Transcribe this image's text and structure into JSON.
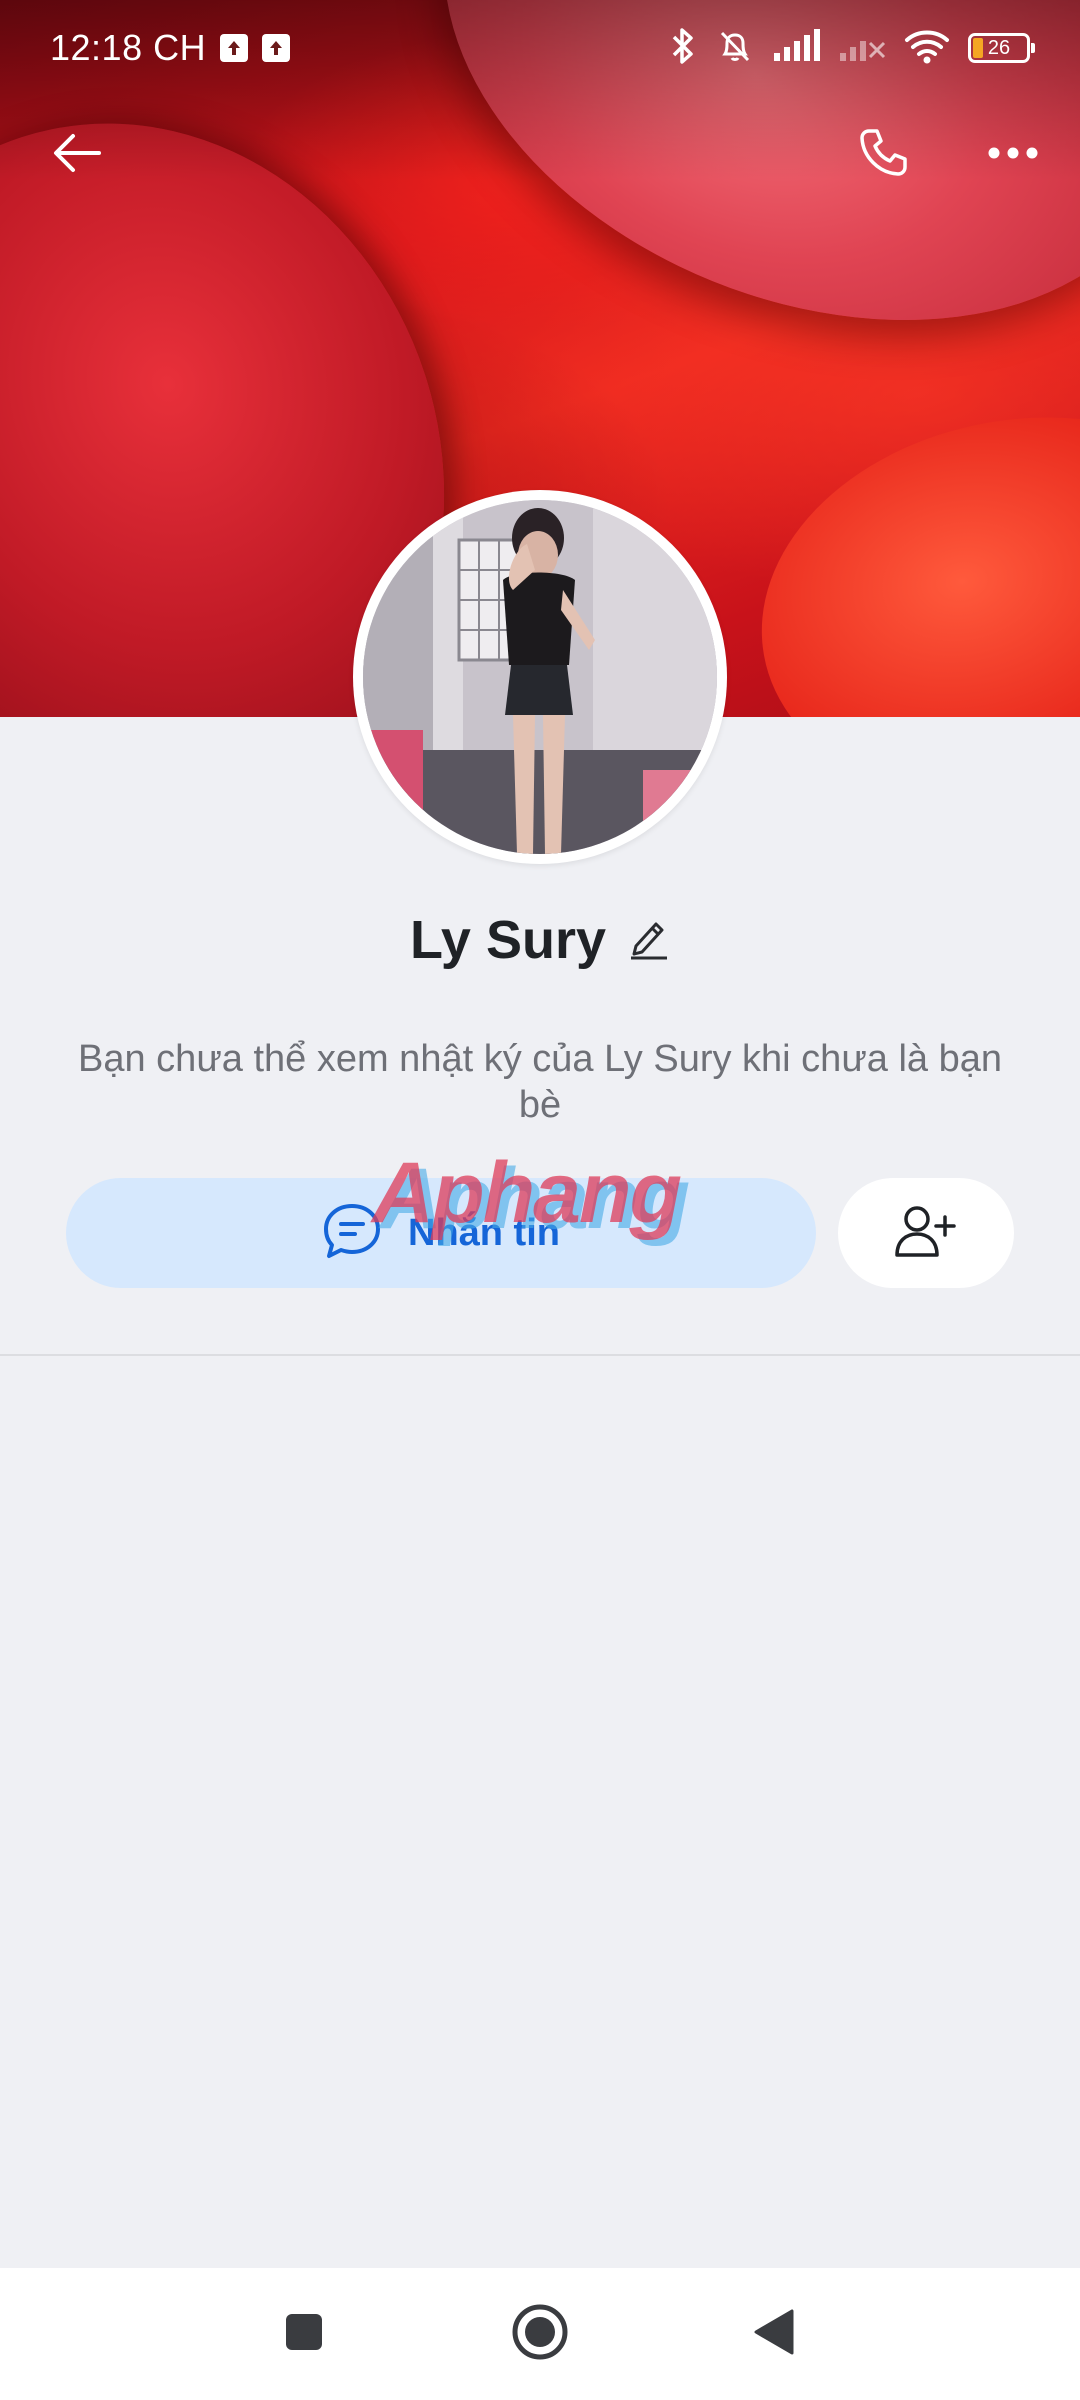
{
  "status_bar": {
    "time": "12:18 CH",
    "battery_level": "26",
    "icons": [
      "upload-icon",
      "upload-icon",
      "bluetooth-icon",
      "bell-off-icon",
      "signal-icon",
      "signal-off-icon",
      "wifi-icon",
      "battery-icon"
    ]
  },
  "header": {
    "icons": [
      "arrow-left-icon",
      "phone-icon",
      "more-dots-icon"
    ]
  },
  "profile": {
    "name": "Ly Sury",
    "edit_icon": "pencil-icon",
    "privacy_notice": "Bạn chưa thể xem nhật ký của Ly Sury khi chưa là bạn bè"
  },
  "actions": {
    "message_label": "Nhắn tin",
    "message_icon": "chat-bubble-icon",
    "add_friend_icon": "user-plus-icon"
  },
  "watermark": {
    "text": "Aphang"
  },
  "system_nav": {
    "icons": [
      "square-icon",
      "circle-icon",
      "triangle-back-icon"
    ]
  },
  "colors": {
    "accent": "#1565d8",
    "message_button_bg": "#d6e8fd",
    "page_bg": "#eff0f4"
  }
}
